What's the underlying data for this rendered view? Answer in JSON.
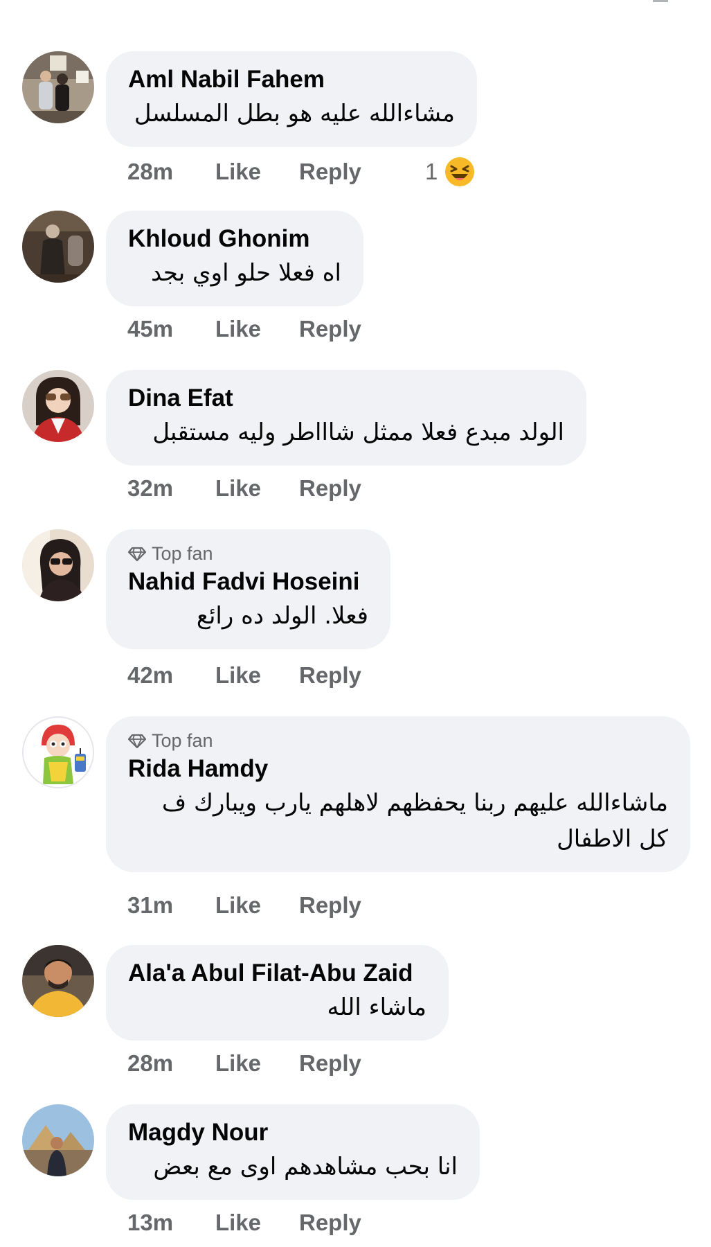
{
  "comments": [
    {
      "author": "Aml Nabil Fahem",
      "text": "مشاءالله عليه هو بطل المسلسل",
      "time": "28m",
      "like_label": "Like",
      "reply_label": "Reply",
      "reaction_count": "1",
      "reaction_icon": "haha-emoji-icon"
    },
    {
      "author": "Khloud Ghonim",
      "text": "اه فعلا حلو اوي بجد",
      "time": "45m",
      "like_label": "Like",
      "reply_label": "Reply"
    },
    {
      "author": "Dina Efat",
      "text": "الولد مبدع فعلا ممثل شاااطر وليه مستقبل",
      "time": "32m",
      "like_label": "Like",
      "reply_label": "Reply"
    },
    {
      "badge": "Top fan",
      "author": "Nahid Fadvi Hoseini",
      "text": "فعلا.  الولد ده رائع",
      "time": "42m",
      "like_label": "Like",
      "reply_label": "Reply"
    },
    {
      "badge": "Top fan",
      "author": "Rida Hamdy",
      "text": "ماشاءالله عليهم ربنا يحفظهم لاهلهم يارب ويبارك ف كل الاطفال",
      "time": "31m",
      "like_label": "Like",
      "reply_label": "Reply"
    },
    {
      "author": "Ala'a Abul Filat-Abu Zaid",
      "text": "ماشاء الله",
      "time": "28m",
      "like_label": "Like",
      "reply_label": "Reply"
    },
    {
      "author": "Magdy Nour",
      "text": "انا بحب مشاهدهم اوى مع بعض",
      "time": "13m",
      "like_label": "Like",
      "reply_label": "Reply"
    }
  ],
  "colors": {
    "bubble": "#f0f2f5",
    "meta_text": "#65676b",
    "name_text": "#050505",
    "reaction_yellow": "#f7b928"
  }
}
